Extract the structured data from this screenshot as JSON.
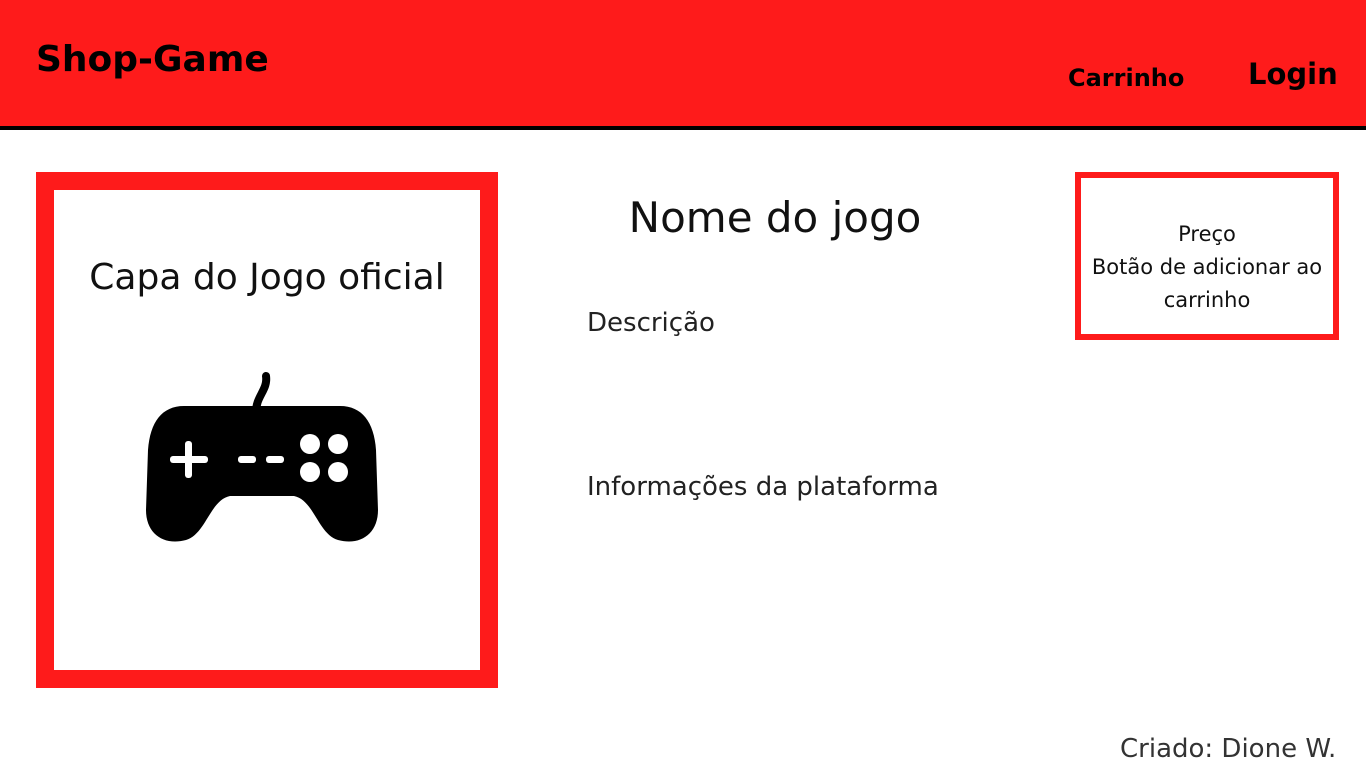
{
  "header": {
    "logo": "Shop-Game",
    "nav_cart": "Carrinho",
    "nav_login": "Login"
  },
  "cover": {
    "title": "Capa do Jogo oficial",
    "icon": "gamepad-icon"
  },
  "game": {
    "name": "Nome do jogo",
    "description": "Descrição",
    "platform_info": "Informações da plataforma"
  },
  "purchase": {
    "price": "Preço",
    "add_button_line1": "Botão de adicionar ao",
    "add_button_line2": "carrinho"
  },
  "footer": {
    "credit": "Criado: Dione W."
  },
  "colors": {
    "brand_red": "#fe1b1b",
    "header_border": "#000000"
  }
}
